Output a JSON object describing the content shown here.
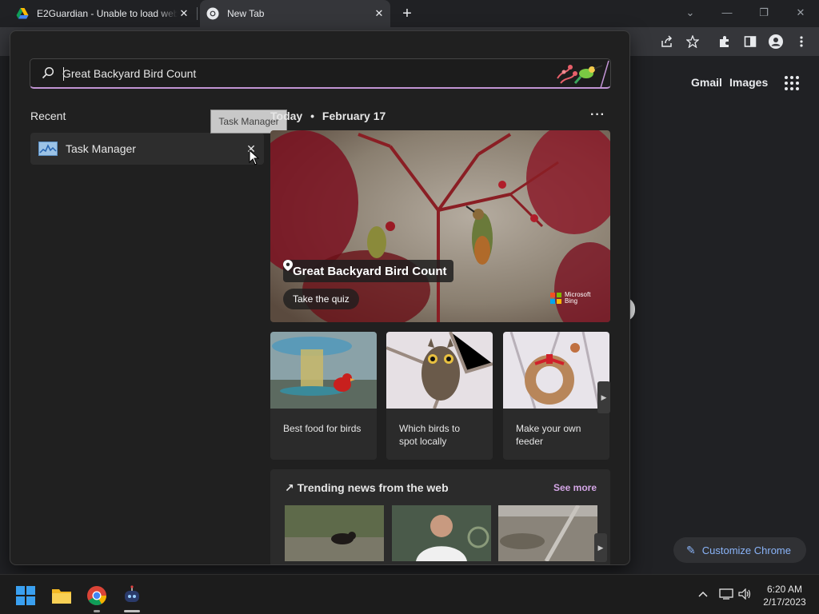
{
  "browser": {
    "tabs": [
      {
        "title": "E2Guardian - Unable to load web",
        "close": "✕"
      },
      {
        "title": "New Tab",
        "close": "✕"
      }
    ],
    "new_tab": "+",
    "window_controls": {
      "dropdown": "⌄",
      "minimize": "—",
      "restore": "❐",
      "close": "✕"
    }
  },
  "ntp": {
    "gmail": "Gmail",
    "images": "Images",
    "customize_chrome": "Customize Chrome"
  },
  "search": {
    "query": "Great Backyard Bird Count",
    "recent_heading": "Recent",
    "recent_items": [
      {
        "label": "Task Manager",
        "remove": "✕"
      }
    ],
    "tooltip": "Task Manager",
    "today_label": "Today",
    "date_sep": "•",
    "date": "February 17",
    "more": "···",
    "hero": {
      "title": "Great Backyard Bird Count",
      "cta": "Take the quiz",
      "brand_line1": "Microsoft",
      "brand_line2": "Bing"
    },
    "cards": [
      {
        "caption": "Best food for birds"
      },
      {
        "caption": "Which birds to spot locally"
      },
      {
        "caption": "Make your own feeder"
      }
    ],
    "trending": {
      "heading": "Trending news from the web",
      "see_more": "See more"
    }
  },
  "taskbar": {
    "time": "6:20 AM",
    "date": "2/17/2023",
    "tray_chevron": "^"
  },
  "colors": {
    "accent": "#c294d4",
    "chrome_link": "#8ab4f8",
    "see_more": "#d4a6e6"
  }
}
